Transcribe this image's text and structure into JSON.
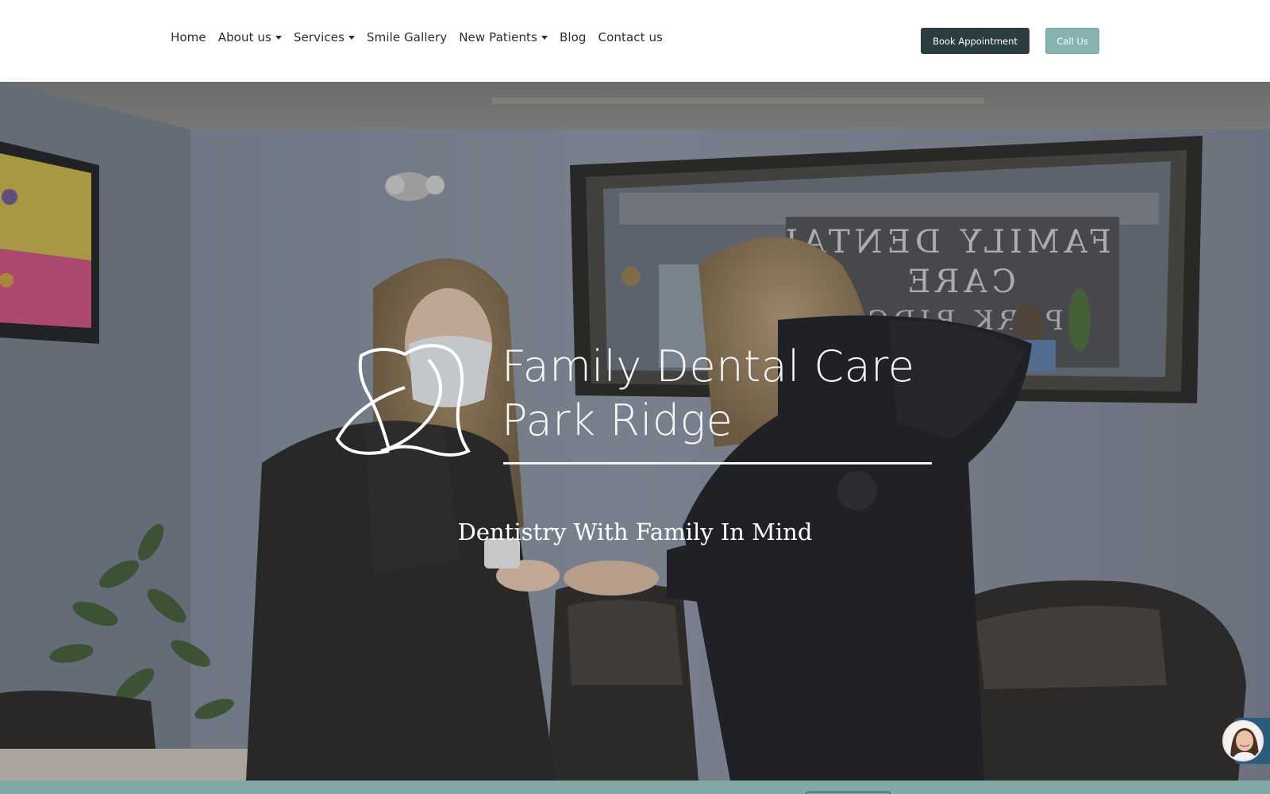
{
  "nav": {
    "items": [
      {
        "label": "Home",
        "dropdown": false
      },
      {
        "label": "About us",
        "dropdown": true
      },
      {
        "label": "Services",
        "dropdown": true
      },
      {
        "label": "Smile Gallery",
        "dropdown": false
      },
      {
        "label": "New Patients",
        "dropdown": true
      },
      {
        "label": "Blog",
        "dropdown": false
      },
      {
        "label": "Contact us",
        "dropdown": false
      }
    ]
  },
  "header": {
    "book_label": "Book Appointment",
    "call_label": "Call Us"
  },
  "hero": {
    "logo_line1": "Family Dental Care",
    "logo_line2": "Park Ridge",
    "tagline": "Dentistry With Family In Mind"
  },
  "colors": {
    "primary_dark": "#2c3e41",
    "accent_teal": "#86b3b2",
    "band_teal": "#7fa8a6",
    "chat_blue": "#2c5c7c"
  },
  "icons": {
    "logo": "tooth-logo-icon",
    "caret": "caret-down-icon",
    "chat": "chat-avatar-icon"
  }
}
